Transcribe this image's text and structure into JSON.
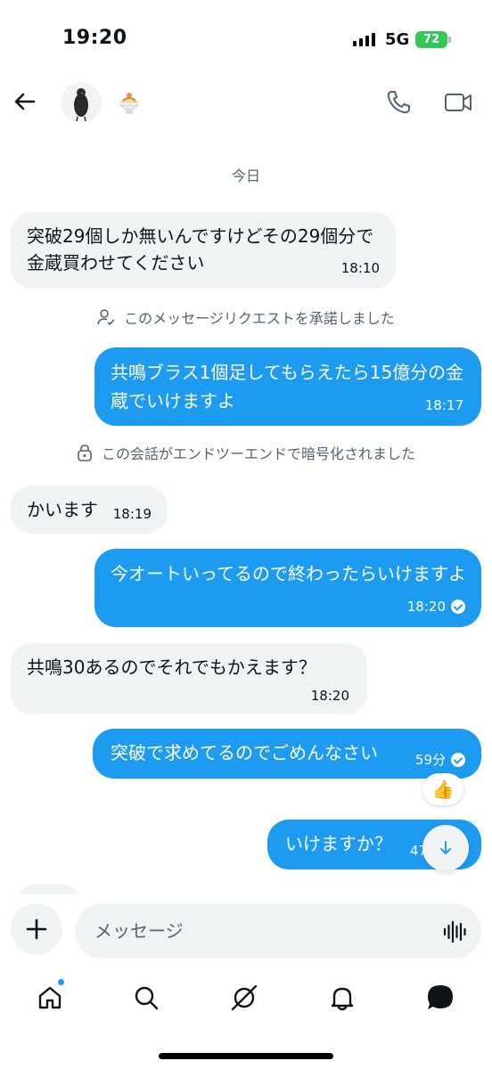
{
  "status_bar": {
    "time": "19:20",
    "network": "5G",
    "battery": "72"
  },
  "header": {
    "back_label": "back",
    "avatar_emoji": "🍧"
  },
  "conversation": {
    "day_label": "今日",
    "messages": [
      {
        "direction": "in",
        "text": "突破29個しか無いんですけどその29個分で金蔵買わせてください",
        "time": "18:10"
      },
      {
        "direction": "out",
        "text": "共鳴ブラス1個足してもらえたら15億分の金蔵でいけますよ",
        "time": "18:17"
      },
      {
        "direction": "in",
        "text": "かいます",
        "time": "18:19"
      },
      {
        "direction": "out",
        "text": "今オートいってるので終わったらいけますよ",
        "time": "18:20"
      },
      {
        "direction": "in",
        "text": "共鳴30あるのでそれでもかえます？",
        "time": "18:20"
      },
      {
        "direction": "out",
        "text": "突破で求めてるのでごめんなさい",
        "time": "59分"
      },
      {
        "direction": "out",
        "text": "いけますか？",
        "time": "47"
      }
    ],
    "system_notes": {
      "request_accepted": "このメッセージリクエストを承諾しました",
      "encrypted": "この会話がエンドツーエンドで暗号化されました"
    },
    "reaction_emoji": "👍"
  },
  "composer": {
    "placeholder": "メッセージ"
  },
  "icons": {
    "back": "arrow-left-icon",
    "phone": "phone-icon",
    "video": "video-icon",
    "add": "plus-icon",
    "voice": "voice-wave-icon",
    "scroll_down": "arrow-down-icon",
    "nav": [
      "home-icon",
      "search-icon",
      "grok-icon",
      "bell-icon",
      "messages-icon"
    ]
  },
  "colors": {
    "accent": "#1d9bf0",
    "incoming_bubble": "#eff3f4",
    "battery": "#34c759",
    "muted_text": "#536471"
  }
}
